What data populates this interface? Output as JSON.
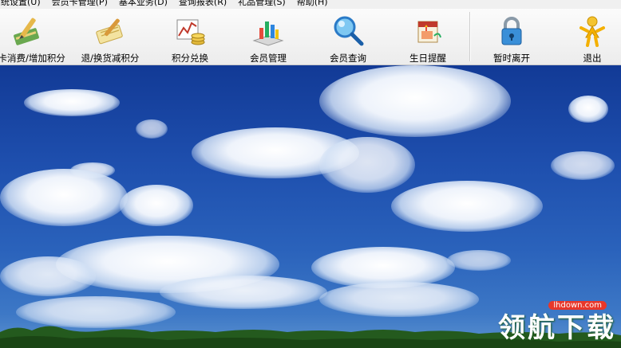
{
  "menu": [
    "系统设置(U)",
    "会员卡管理(P)",
    "基本业务(D)",
    "查询报表(R)",
    "礼品管理(S)",
    "帮助(H)"
  ],
  "toolbar": {
    "card_consume": "刷卡消费/增加积分",
    "return_points": "退/换货减积分",
    "points_exchange": "积分兑换",
    "member_manage": "会员管理",
    "member_query": "会员查询",
    "birthday_remind": "生日提醒",
    "temp_leave": "暂时离开",
    "exit": "退出"
  },
  "icons": {
    "card_consume": "pen-card-icon",
    "return_points": "pen-card-return-icon",
    "points_exchange": "chart-coins-icon",
    "member_manage": "bar-chart-icon",
    "member_query": "magnifier-icon",
    "birthday_remind": "birthday-icon",
    "temp_leave": "padlock-icon",
    "exit": "exit-person-icon"
  },
  "watermark": {
    "site": "lhdown.com",
    "text": "领航下载"
  },
  "colors": {
    "sky": "#1c4aa8",
    "toolbar": "#f0f0f0",
    "watermark_accent": "#e8372a"
  }
}
